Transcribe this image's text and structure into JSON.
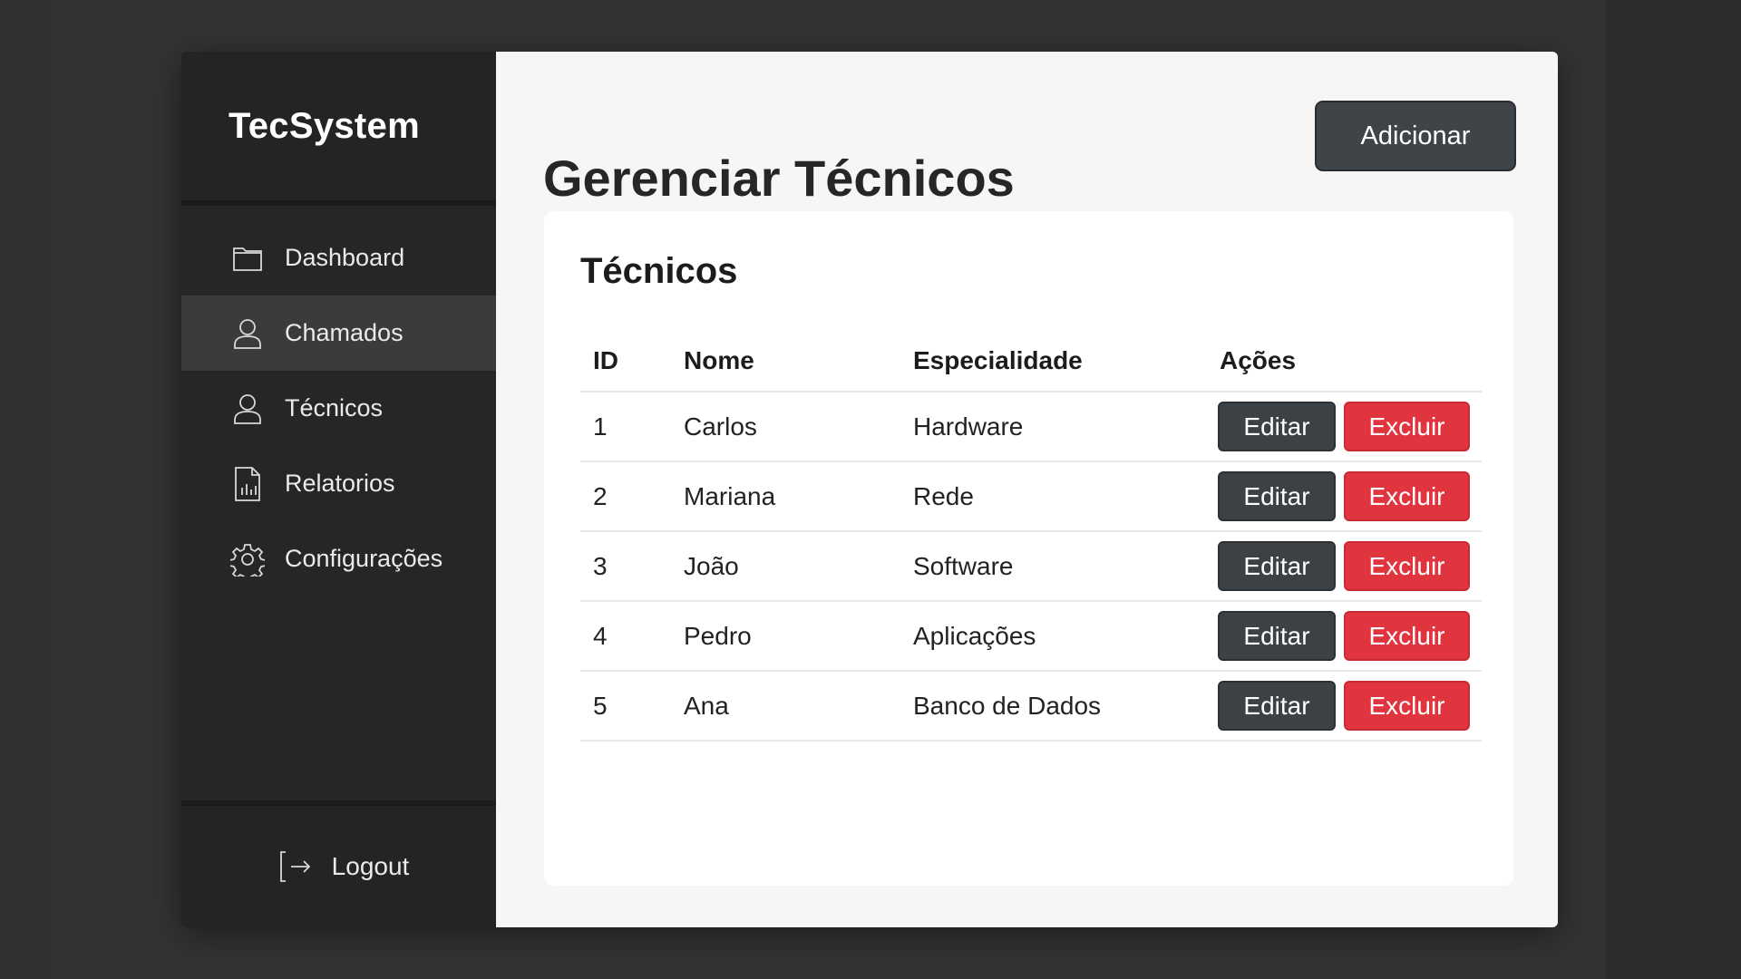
{
  "brand": {
    "name": "TecSystem"
  },
  "sidebar": {
    "items": [
      {
        "label": "Dashboard",
        "icon": "folder-icon",
        "active": false
      },
      {
        "label": "Chamados",
        "icon": "user-icon",
        "active": true
      },
      {
        "label": "Técnicos",
        "icon": "user-icon",
        "active": false
      },
      {
        "label": "Relatorios",
        "icon": "report-icon",
        "active": false
      },
      {
        "label": "Configurações",
        "icon": "gear-icon",
        "active": false
      }
    ],
    "logout": {
      "label": "Logout",
      "icon": "logout-icon"
    }
  },
  "main": {
    "title": "Gerenciar Técnicos",
    "add_label": "Adicionar",
    "card": {
      "title": "Técnicos",
      "columns": [
        "ID",
        "Nome",
        "Especialidade",
        "Ações"
      ],
      "rows": [
        {
          "id": "1",
          "nome": "Carlos",
          "especialidade": "Hardware"
        },
        {
          "id": "2",
          "nome": "Mariana",
          "especialidade": "Rede"
        },
        {
          "id": "3",
          "nome": "João",
          "especialidade": "Software"
        },
        {
          "id": "4",
          "nome": "Pedro",
          "especialidade": "Aplicações"
        },
        {
          "id": "5",
          "nome": "Ana",
          "especialidade": "Banco de Dados"
        }
      ],
      "edit_label": "Editar",
      "delete_label": "Excluir"
    }
  },
  "colors": {
    "sidebar_bg": "#262626",
    "active_item_bg": "#3b3b3b",
    "main_bg": "#f6f6f6",
    "dark_button": "#3f4448",
    "danger_button": "#e0353f"
  }
}
